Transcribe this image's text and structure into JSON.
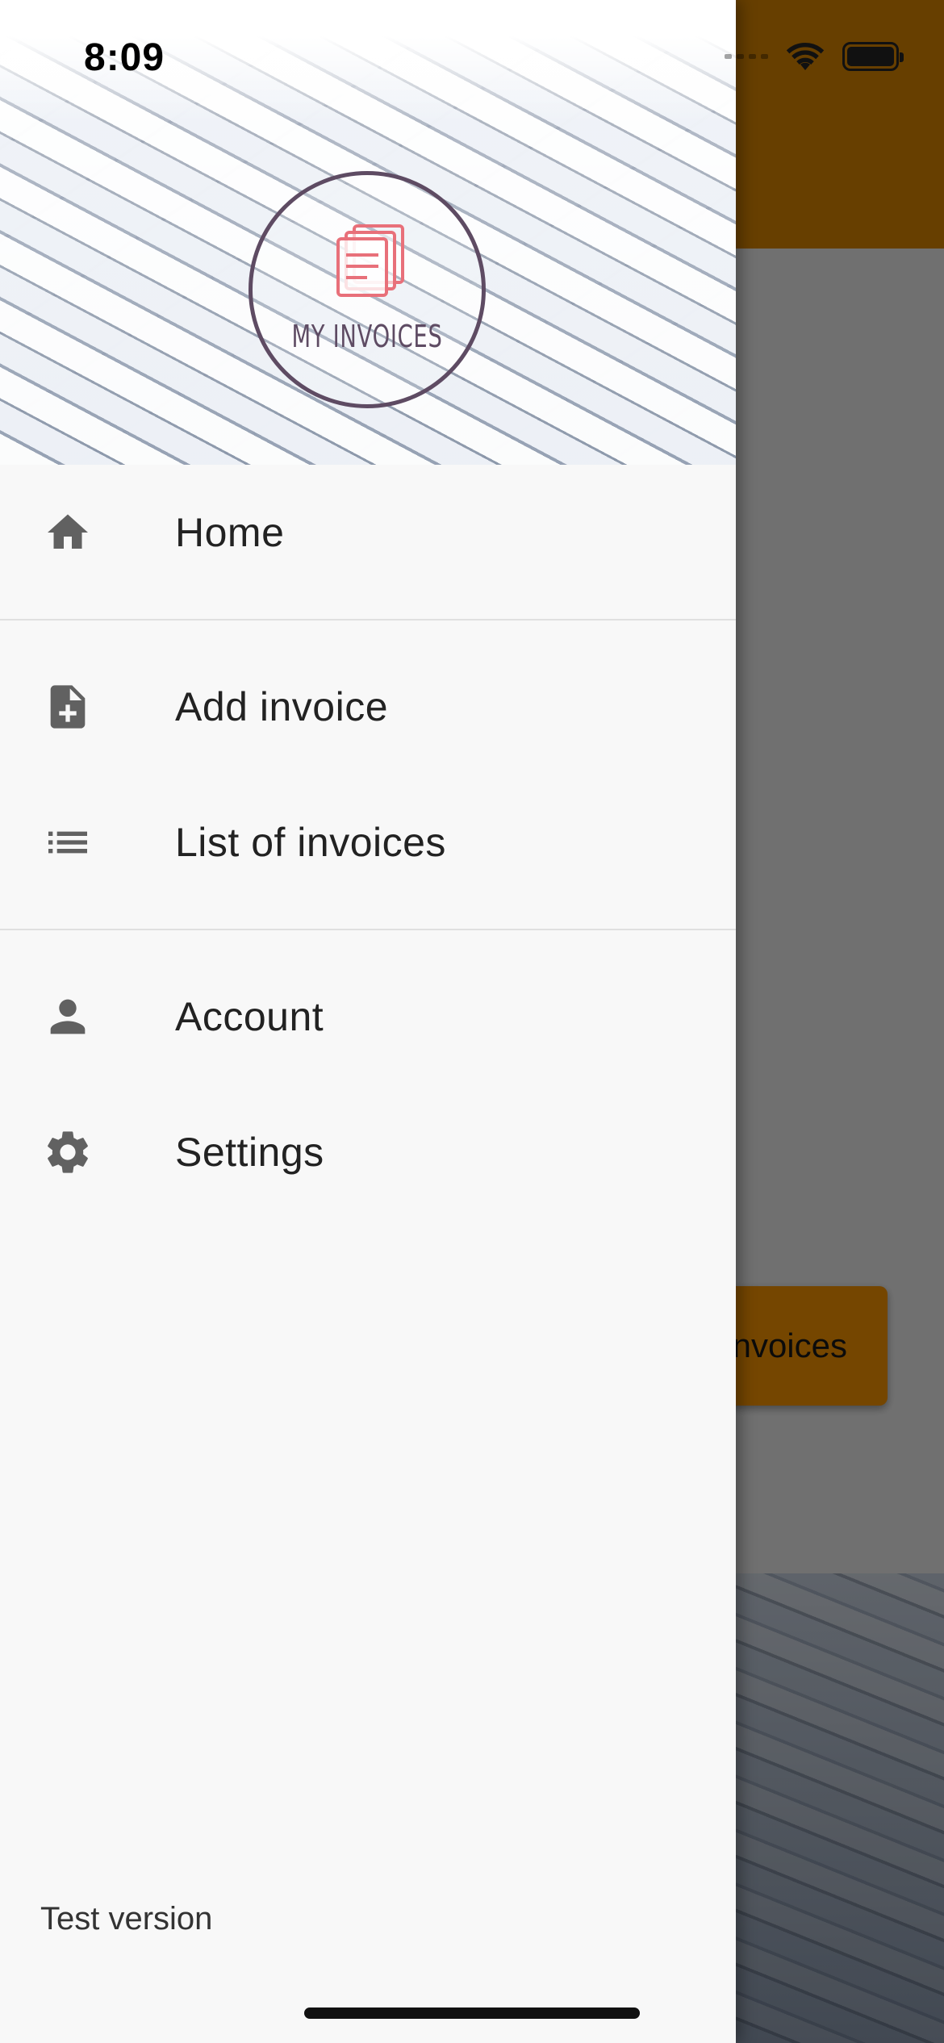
{
  "status_bar": {
    "time": "8:09",
    "icons": [
      "signal-icon",
      "wifi-icon",
      "battery-icon"
    ]
  },
  "background_app": {
    "appbar_color": "#e08a00",
    "button_label": "nvoices",
    "button_color": "#ff9800"
  },
  "drawer": {
    "header": {
      "logo_text": "MY INVOICES",
      "logo_ring_color": "#5e4b63",
      "logo_icon_color": "#e8707a"
    },
    "sections": [
      {
        "items": [
          {
            "icon": "home-icon",
            "label": "Home"
          }
        ]
      },
      {
        "items": [
          {
            "icon": "add-document-icon",
            "label": "Add invoice"
          },
          {
            "icon": "list-icon",
            "label": "List of invoices"
          }
        ]
      },
      {
        "items": [
          {
            "icon": "person-icon",
            "label": "Account"
          },
          {
            "icon": "gear-icon",
            "label": "Settings"
          }
        ]
      }
    ],
    "footer_text": "Test version"
  }
}
